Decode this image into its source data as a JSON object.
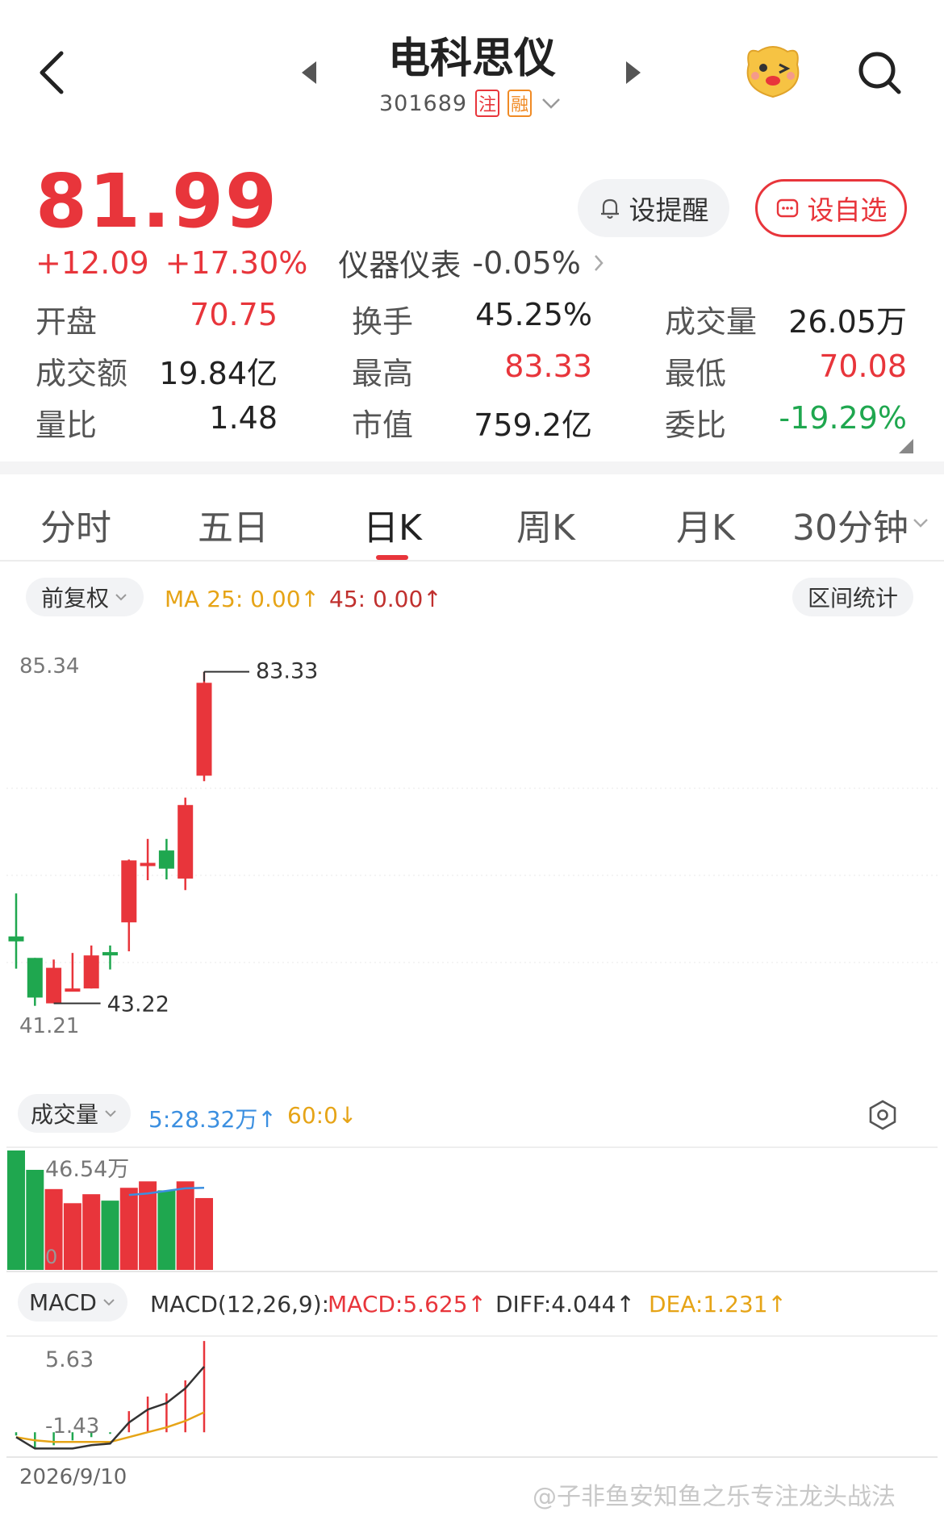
{
  "header": {
    "stock_name": "电科思仪",
    "stock_code": "301689",
    "tag_registered": "注",
    "tag_margin": "融",
    "icons": [
      "back-icon",
      "prev-arrow-icon",
      "next-arrow-icon",
      "mascot-icon",
      "search-icon"
    ]
  },
  "quote": {
    "price": "81.99",
    "change": "+12.09",
    "change_pct": "+17.30%",
    "industry": "仪器仪表",
    "industry_change": "-0.05%",
    "alert_label": "设提醒",
    "watch_label": "设自选"
  },
  "stats": [
    [
      {
        "label": "开盘",
        "value": "70.75",
        "color": "red"
      },
      {
        "label": "换手",
        "value": "45.25%",
        "color": "black"
      },
      {
        "label": "成交量",
        "value": "26.05万",
        "color": "black"
      }
    ],
    [
      {
        "label": "成交额",
        "value": "19.84亿",
        "color": "black"
      },
      {
        "label": "最高",
        "value": "83.33",
        "color": "red"
      },
      {
        "label": "最低",
        "value": "70.08",
        "color": "red"
      }
    ],
    [
      {
        "label": "量比",
        "value": "1.48",
        "color": "black"
      },
      {
        "label": "市值",
        "value": "759.2亿",
        "color": "black"
      },
      {
        "label": "委比",
        "value": "-19.29%",
        "color": "green"
      }
    ]
  ],
  "tabs": [
    "分时",
    "五日",
    "日K",
    "周K",
    "月K",
    "30分钟"
  ],
  "active_tab": "日K",
  "kline_toolbar": {
    "adjust": "前复权",
    "ma25": "MA 25: 0.00↑",
    "ma45": "45: 0.00↑",
    "range_stats": "区间统计"
  },
  "kline_labels": {
    "axis_top": "85.34",
    "axis_bottom": "41.21",
    "high_mark": "83.33",
    "low_mark": "43.22"
  },
  "vol_toolbar": {
    "title": "成交量",
    "ma5": "5:28.32万↑",
    "ma60": "60:0↓"
  },
  "vol_labels": {
    "axis_top": "46.54万",
    "axis_bottom": "0"
  },
  "macd_toolbar": {
    "title": "MACD",
    "params": "MACD(12,26,9):",
    "macd": "MACD:5.625↑",
    "diff": "DIFF:4.044↑",
    "dea": "DEA:1.231↑"
  },
  "macd_labels": {
    "axis_top": "5.63",
    "axis_bottom": "-1.43"
  },
  "date": "2026/9/10",
  "watermark": "@子非鱼安知鱼之乐专注龙头战法",
  "colors": {
    "up": "#e8353b",
    "down": "#1fa74f",
    "ma5": "#3b8fe0",
    "ma60": "#e6a417",
    "dea": "#e6a417"
  },
  "chart_data": {
    "type": "candlestick",
    "x": [
      1,
      2,
      3,
      4,
      5,
      6,
      7,
      8,
      9,
      10,
      11
    ],
    "ohlc": [
      {
        "open": 51.3,
        "high": 56.5,
        "low": 47.4,
        "close": 50.7,
        "dir": "down"
      },
      {
        "open": 48.7,
        "high": 48.7,
        "low": 42.9,
        "close": 43.9,
        "dir": "down"
      },
      {
        "open": 43.2,
        "high": 48.5,
        "low": 43.2,
        "close": 47.5,
        "dir": "up"
      },
      {
        "open": 45.0,
        "high": 49.3,
        "low": 44.8,
        "close": 44.9,
        "dir": "up"
      },
      {
        "open": 45.0,
        "high": 50.2,
        "low": 45.0,
        "close": 49.0,
        "dir": "up"
      },
      {
        "open": 49.0,
        "high": 50.2,
        "low": 47.3,
        "close": 49.4,
        "dir": "down"
      },
      {
        "open": 53.0,
        "high": 60.6,
        "low": 49.5,
        "close": 60.5,
        "dir": "up"
      },
      {
        "open": 60.0,
        "high": 63.1,
        "low": 58.1,
        "close": 60.2,
        "dir": "up"
      },
      {
        "open": 61.7,
        "high": 63.1,
        "low": 58.2,
        "close": 59.5,
        "dir": "down"
      },
      {
        "open": 58.3,
        "high": 68.1,
        "low": 56.9,
        "close": 67.2,
        "dir": "up"
      },
      {
        "open": 70.75,
        "high": 83.33,
        "low": 70.08,
        "close": 81.99,
        "dir": "up"
      }
    ],
    "volume": [
      46.54,
      39.0,
      31.5,
      26.0,
      29.5,
      27.0,
      32.0,
      34.5,
      31.0,
      34.5,
      28.0
    ],
    "volume_dir": [
      "down",
      "down",
      "up",
      "up",
      "up",
      "down",
      "up",
      "up",
      "down",
      "up",
      "up"
    ],
    "macd_hist": [
      -0.2,
      -1.0,
      -0.8,
      -0.5,
      -0.3,
      -0.1,
      1.3,
      2.2,
      2.4,
      3.2,
      5.625
    ],
    "diff": [
      -0.3,
      -1.0,
      -1.0,
      -1.0,
      -0.8,
      -0.7,
      0.6,
      1.4,
      1.8,
      2.7,
      4.044
    ],
    "dea": [
      -0.3,
      -0.5,
      -0.6,
      -0.6,
      -0.6,
      -0.6,
      -0.3,
      0.0,
      0.3,
      0.7,
      1.231
    ],
    "price_range": [
      41.21,
      85.34
    ],
    "volume_range": [
      0,
      46.54
    ],
    "macd_range": [
      -1.43,
      5.63
    ]
  }
}
